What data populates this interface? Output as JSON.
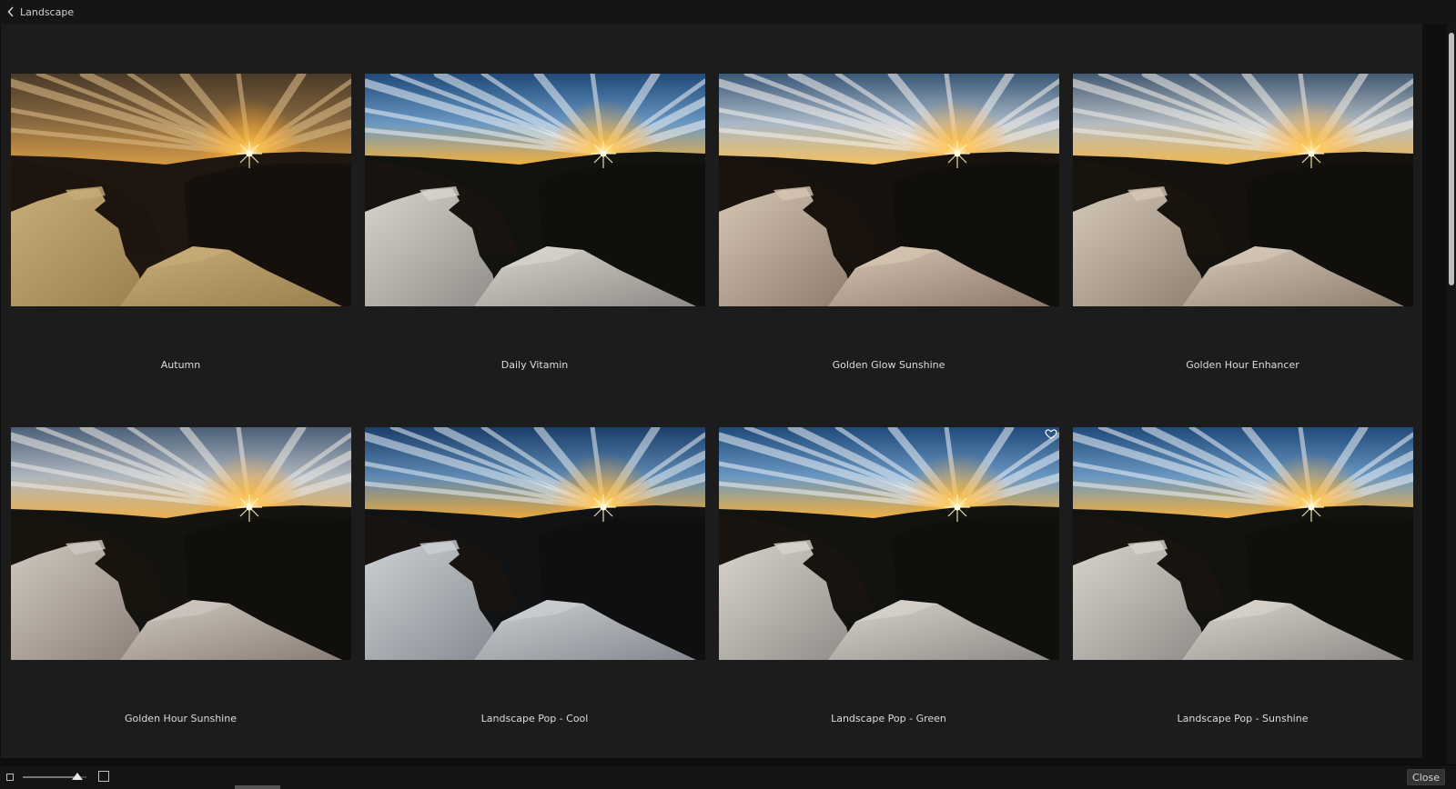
{
  "header": {
    "title": "Landscape"
  },
  "presets": [
    {
      "label": "Autumn",
      "style": "autumn",
      "favorite": false
    },
    {
      "label": "Daily Vitamin",
      "style": "vivid",
      "favorite": false
    },
    {
      "label": "Golden Glow Sunshine",
      "style": "glow",
      "favorite": false
    },
    {
      "label": "Golden Hour Enhancer",
      "style": "warm",
      "favorite": false
    },
    {
      "label": "Golden Hour Sunshine",
      "style": "natural",
      "favorite": false
    },
    {
      "label": "Landscape Pop - Cool",
      "style": "cool",
      "favorite": false
    },
    {
      "label": "Landscape Pop - Green",
      "style": "vivid",
      "favorite": true
    },
    {
      "label": "Landscape Pop - Sunshine",
      "style": "vivid",
      "favorite": false
    }
  ],
  "footer": {
    "close_label": "Close",
    "thumbnail_size": 0.85
  },
  "colors": {
    "accent": "#ffffff",
    "background": "#1c1c1c"
  }
}
